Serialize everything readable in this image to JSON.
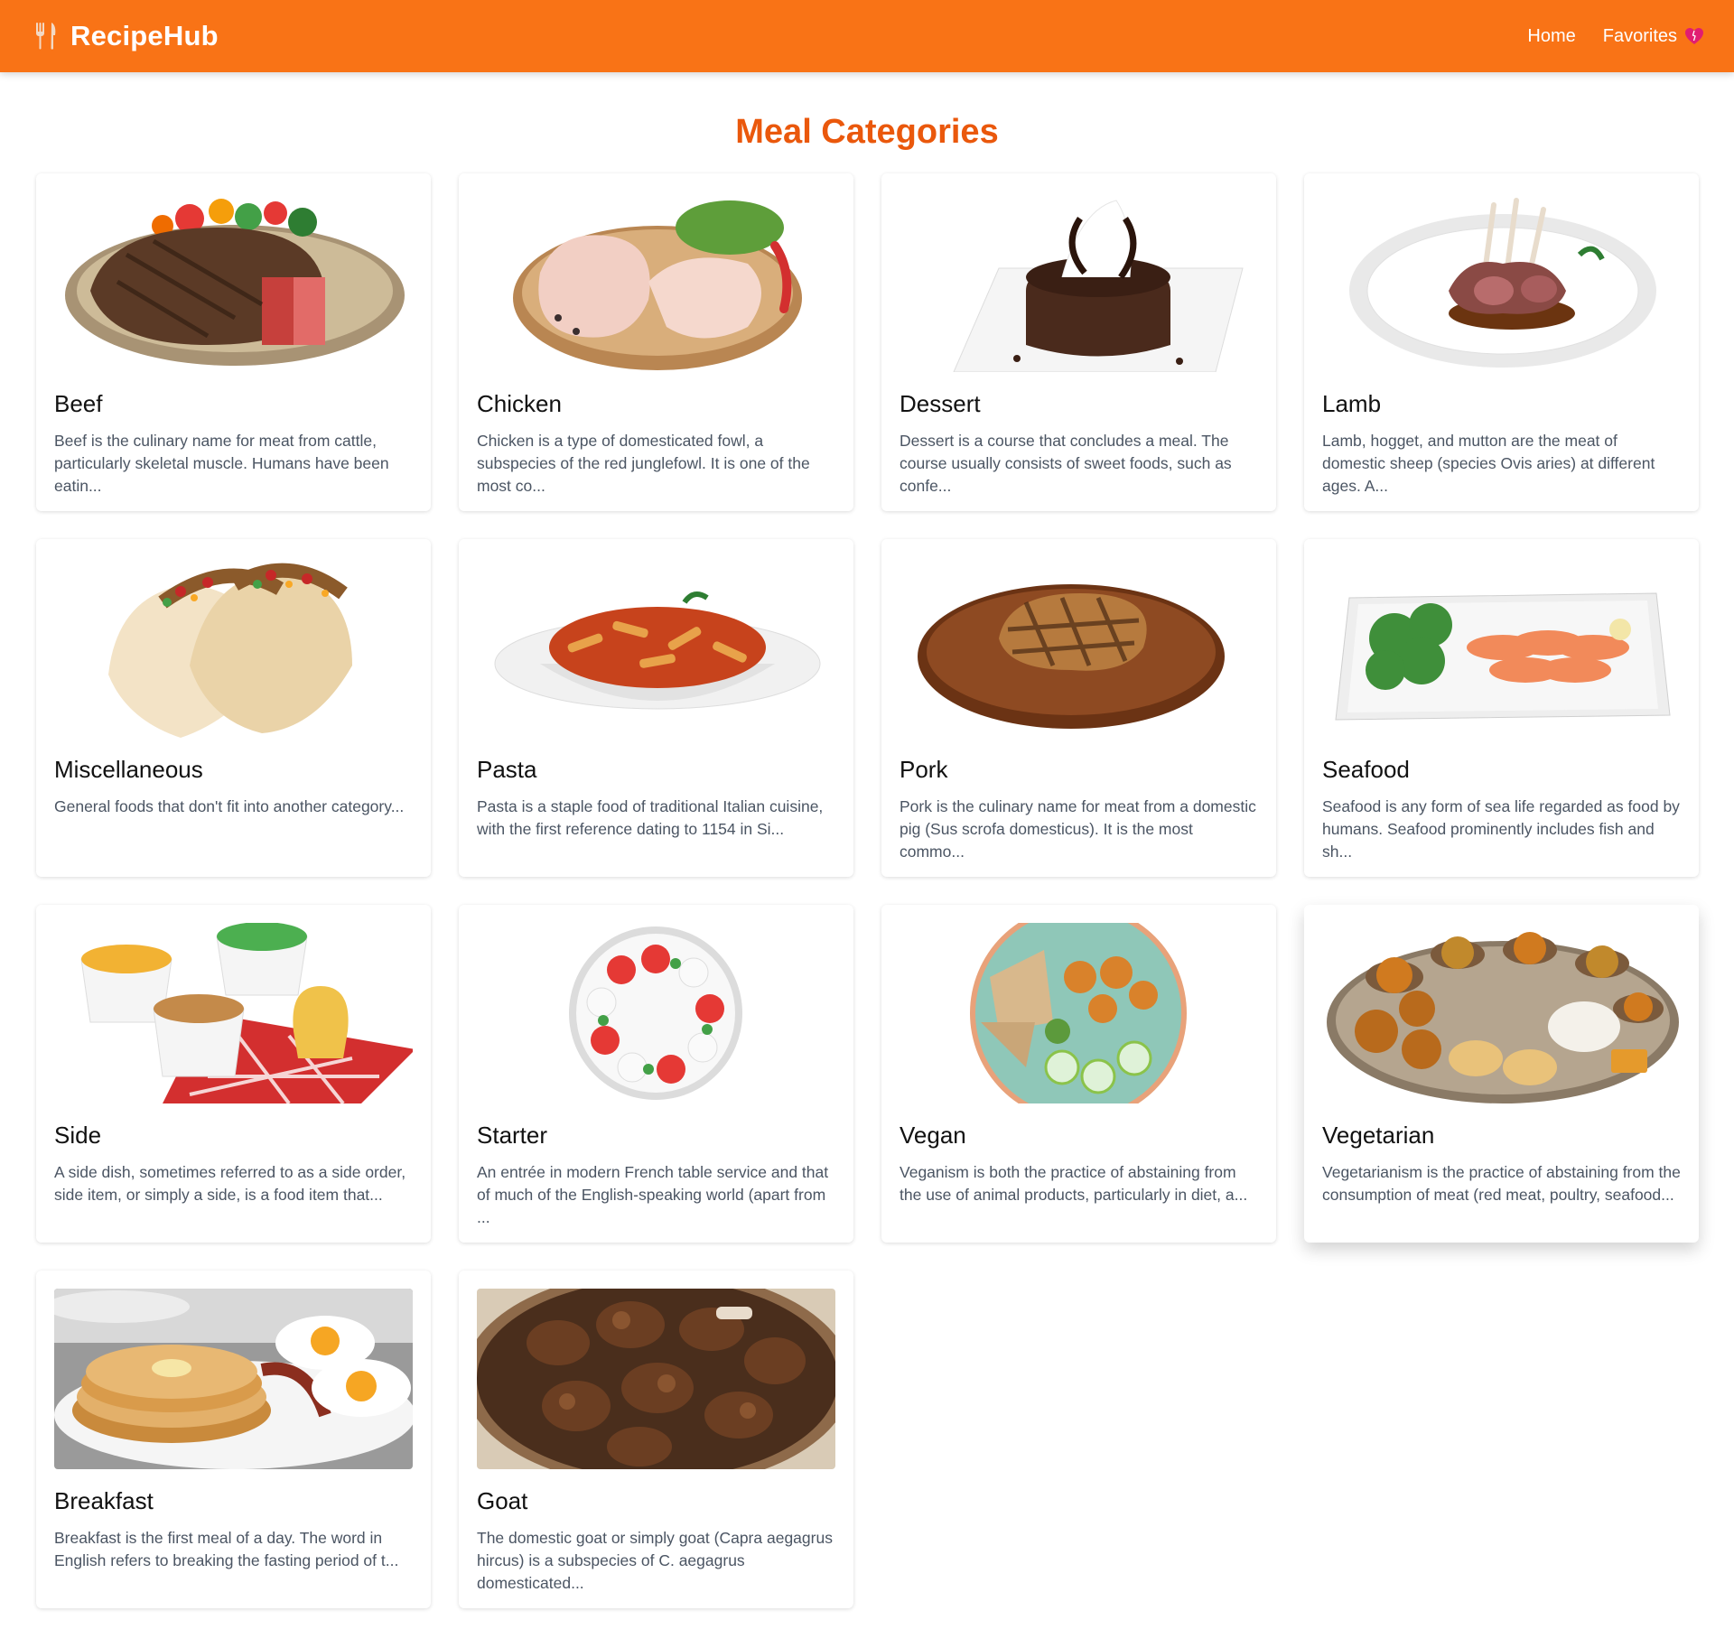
{
  "nav": {
    "brand": "RecipeHub",
    "brand_icon": "fork-knife-icon",
    "links": [
      {
        "label": "Home"
      },
      {
        "label": "Favorites",
        "icon": "heart-icon"
      }
    ]
  },
  "colors": {
    "nav_bg": "#f97316",
    "title": "#ea580c"
  },
  "page_title": "Meal Categories",
  "categories": [
    {
      "name": "Beef",
      "desc": "Beef is the culinary name for meat from cattle, particularly skeletal muscle. Humans have been eatin...",
      "image": "beef-steak-image"
    },
    {
      "name": "Chicken",
      "desc": "Chicken is a type of domesticated fowl, a subspecies of the red junglefowl. It is one of the most co...",
      "image": "raw-chicken-legs-image"
    },
    {
      "name": "Dessert",
      "desc": "Dessert is a course that concludes a meal. The course usually consists of sweet foods, such as confe...",
      "image": "chocolate-cake-image"
    },
    {
      "name": "Lamb",
      "desc": "Lamb, hogget, and mutton are the meat of domestic sheep (species Ovis aries) at different ages. A...",
      "image": "lamb-chops-image"
    },
    {
      "name": "Miscellaneous",
      "desc": "General foods that don't fit into another category...",
      "image": "tacos-image"
    },
    {
      "name": "Pasta",
      "desc": "Pasta is a staple food of traditional Italian cuisine, with the first reference dating to 1154 in Si...",
      "image": "penne-pasta-image"
    },
    {
      "name": "Pork",
      "desc": "Pork is the culinary name for meat from a domestic pig (Sus scrofa domesticus). It is the most commo...",
      "image": "pork-chop-image"
    },
    {
      "name": "Seafood",
      "desc": "Seafood is any form of sea life regarded as food by humans. Seafood prominently includes fish and sh...",
      "image": "salmon-plate-image"
    },
    {
      "name": "Side",
      "desc": "A side dish, sometimes referred to as a side order, side item, or simply a side, is a food item that...",
      "image": "side-dishes-image"
    },
    {
      "name": "Starter",
      "desc": "An entrée in modern French table service and that of much of the English-speaking world (apart from ...",
      "image": "caprese-salad-image"
    },
    {
      "name": "Vegan",
      "desc": "Veganism is both the practice of abstaining from the use of animal products, particularly in diet, a...",
      "image": "vegan-bowl-image"
    },
    {
      "name": "Vegetarian",
      "desc": "Vegetarianism is the practice of abstaining from the consumption of meat (red meat, poultry, seafood...",
      "image": "thali-platter-image"
    },
    {
      "name": "Breakfast",
      "desc": "Breakfast is the first meal of a day. The word in English refers to breaking the fasting period of t...",
      "image": "pancakes-eggs-image"
    },
    {
      "name": "Goat",
      "desc": "The domestic goat or simply goat (Capra aegagrus hircus) is a subspecies of C. aegagrus domesticated...",
      "image": "goat-curry-image"
    }
  ]
}
